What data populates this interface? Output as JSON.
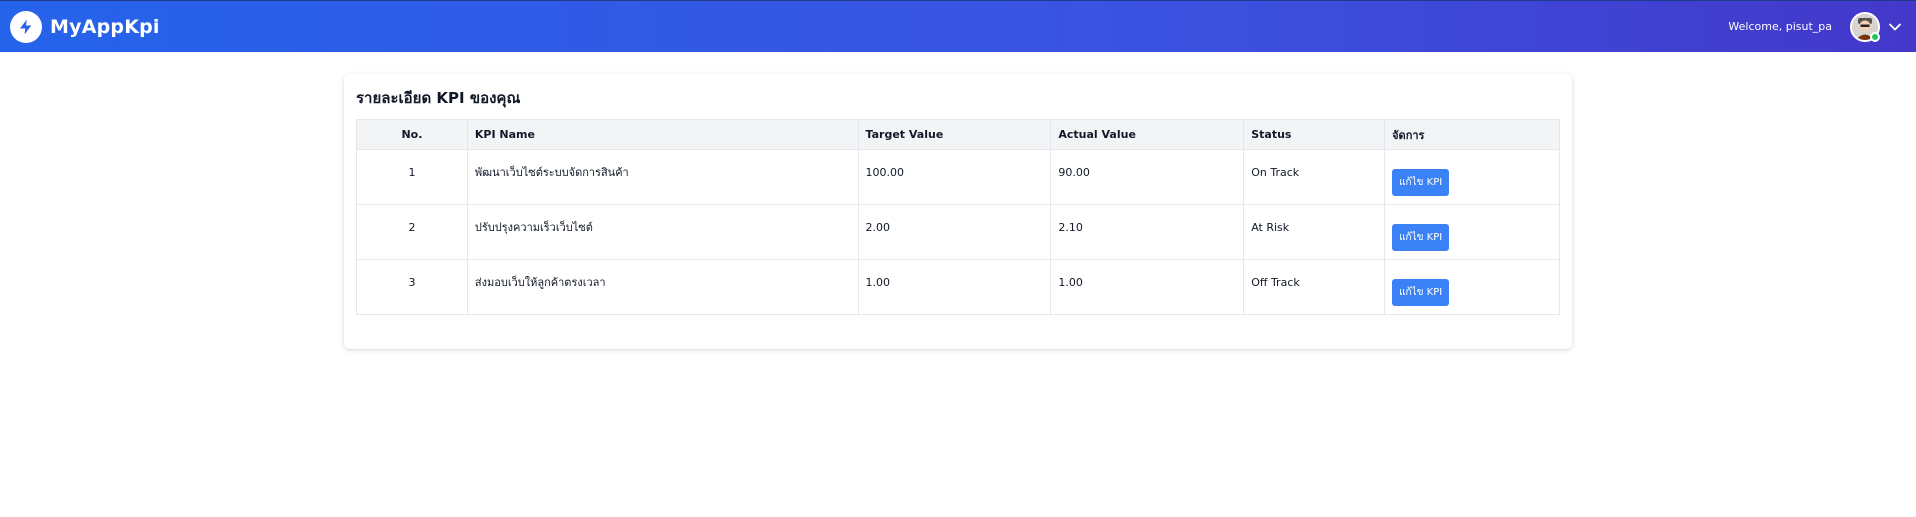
{
  "app": {
    "name": "MyAppKpi"
  },
  "header": {
    "welcome": "Welcome, pisut_pa"
  },
  "page": {
    "title": "รายละเอียด KPI ของคุณ"
  },
  "table": {
    "headers": [
      "No.",
      "KPI Name",
      "Target Value",
      "Actual Value",
      "Status",
      "จัดการ"
    ],
    "rows": [
      {
        "no": "1",
        "name": "พัฒนาเว็บไซต์ระบบจัดการสินค้า",
        "target": "100.00",
        "actual": "90.00",
        "status": "On Track",
        "action": "แก้ไข KPI"
      },
      {
        "no": "2",
        "name": "ปรับปรุงความเร็วเว็บไซต์",
        "target": "2.00",
        "actual": "2.10",
        "status": "At Risk",
        "action": "แก้ไข KPI"
      },
      {
        "no": "3",
        "name": "ส่งมอบเว็บให้ลูกค้าตรงเวลา",
        "target": "1.00",
        "actual": "1.00",
        "status": "Off Track",
        "action": "แก้ไข KPI"
      }
    ]
  },
  "icons": {
    "logo": "lightning-bolt-icon",
    "menu": "chevron-down-icon",
    "avatar": "user-avatar"
  },
  "colors": {
    "nav_start": "#2563eb",
    "nav_end": "#4338ca",
    "button": "#3b82f6",
    "online": "#22c55e"
  }
}
